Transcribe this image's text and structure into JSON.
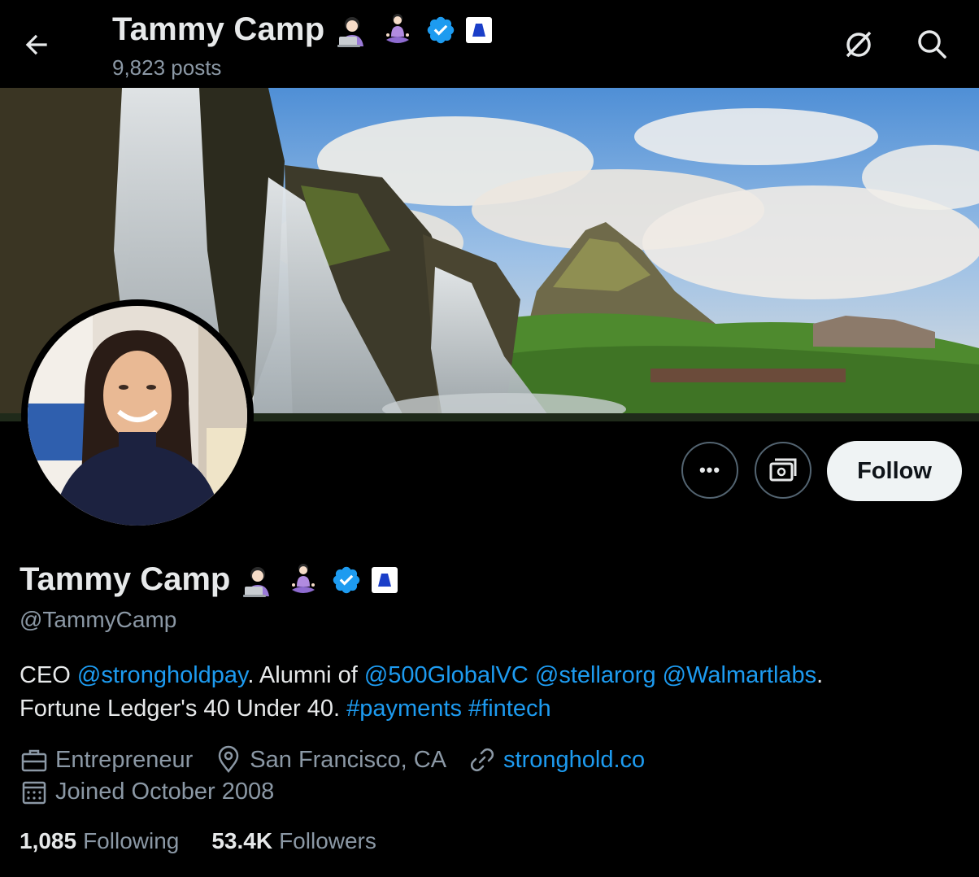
{
  "header": {
    "name": "Tammy Camp",
    "posts": "9,823 posts"
  },
  "icons": {
    "back": "arrow-left-icon",
    "translate": "slashed-circle-icon",
    "search": "search-icon",
    "emoji1": "woman-technologist-emoji",
    "emoji2": "woman-lotus-position-emoji",
    "verified": "verified-badge-icon",
    "affiliate": "affiliate-logo-icon"
  },
  "actions": {
    "more_label": "•••",
    "follow_label": "Follow"
  },
  "profile": {
    "name": "Tammy Camp",
    "handle": "@TammyCamp",
    "bio": {
      "t1": "CEO ",
      "m1": "@strongholdpay",
      "t2": ". Alumni of ",
      "m2": "@500GlobalVC",
      "t3": " ",
      "m3": "@stellarorg",
      "t4": " ",
      "m4": "@Walmartlabs",
      "t5": ".",
      "t6": "Fortune Ledger's 40 Under 40. ",
      "h1": "#payments",
      "t7": " ",
      "h2": "#fintech"
    },
    "category": "Entrepreneur",
    "location": "San Francisco, CA",
    "website": "stronghold.co",
    "joined": "Joined October 2008"
  },
  "stats": {
    "following_count": "1,085",
    "following_label": "Following",
    "followers_count": "53.4K",
    "followers_label": "Followers"
  },
  "colors": {
    "background": "#000000",
    "link": "#1d9bf0",
    "secondary_text": "#8b98a5",
    "follow_bg": "#eff3f4"
  }
}
